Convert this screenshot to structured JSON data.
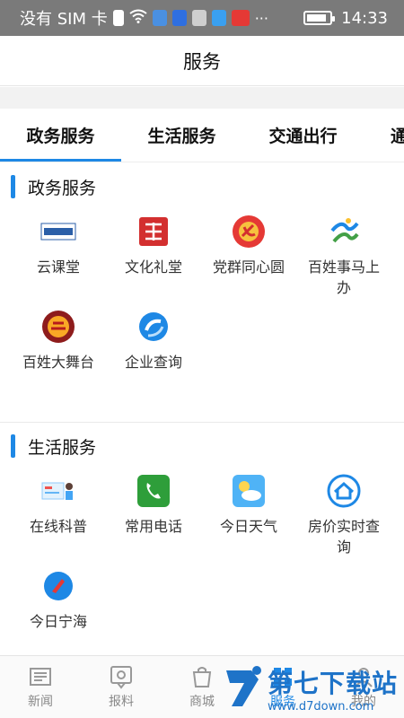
{
  "status_bar": {
    "carrier": "没有 SIM 卡",
    "time": "14:33",
    "battery_level": 0.85,
    "icons": [
      "alert-icon",
      "wifi-icon",
      "music-app-icon",
      "baidu-app-icon",
      "hms-icon",
      "search-app-icon",
      "huawei-app-icon",
      "more-icon"
    ]
  },
  "header": {
    "title": "服务"
  },
  "tabs": [
    {
      "label": "政务服务",
      "active": true
    },
    {
      "label": "生活服务",
      "active": false
    },
    {
      "label": "交通出行",
      "active": false
    },
    {
      "label": "通",
      "active": false
    }
  ],
  "sections": [
    {
      "title": "政务服务",
      "items": [
        {
          "label": "云课堂",
          "icon": "cloud-classroom-icon"
        },
        {
          "label": "文化礼堂",
          "icon": "culture-hall-icon"
        },
        {
          "label": "党群同心圆",
          "icon": "party-emblem-icon"
        },
        {
          "label": "百姓事马上办",
          "icon": "public-affairs-icon"
        },
        {
          "label": "百姓大舞台",
          "icon": "stage-icon"
        },
        {
          "label": "企业查询",
          "icon": "enterprise-query-icon"
        }
      ]
    },
    {
      "title": "生活服务",
      "items": [
        {
          "label": "在线科普",
          "icon": "online-science-icon"
        },
        {
          "label": "常用电话",
          "icon": "phone-icon"
        },
        {
          "label": "今日天气",
          "icon": "weather-icon"
        },
        {
          "label": "房价实时查询",
          "icon": "house-price-icon"
        },
        {
          "label": "今日宁海",
          "icon": "today-ninghai-icon"
        }
      ]
    }
  ],
  "bottom_nav": [
    {
      "label": "新闻",
      "icon": "news-icon"
    },
    {
      "label": "报料",
      "icon": "report-icon"
    },
    {
      "label": "商城",
      "icon": "shop-icon"
    },
    {
      "label": "服务",
      "icon": "service-icon"
    },
    {
      "label": "我的",
      "icon": "profile-icon"
    }
  ],
  "watermark": {
    "main": "第七下载站",
    "sub": "www.d7down.com"
  },
  "colors": {
    "accent": "#1e88e5",
    "statusbar": "#7a7a7a"
  }
}
